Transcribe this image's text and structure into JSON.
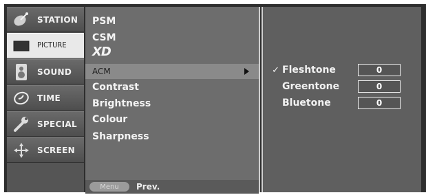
{
  "tabs": [
    {
      "label": "STATION",
      "icon": "satellite-dish-icon",
      "active": false
    },
    {
      "label": "PICTURE",
      "icon": "tv-screen-icon",
      "active": true
    },
    {
      "label": "SOUND",
      "icon": "speaker-icon",
      "active": false
    },
    {
      "label": "TIME",
      "icon": "clock-icon",
      "active": false
    },
    {
      "label": "SPECIAL",
      "icon": "wrench-icon",
      "active": false
    },
    {
      "label": "SCREEN",
      "icon": "screen-adjust-icon",
      "active": false
    }
  ],
  "menu": {
    "items": [
      {
        "label": "PSM"
      },
      {
        "label": "CSM"
      },
      {
        "label": "XD"
      },
      {
        "label": "ACM",
        "selected": true
      },
      {
        "label": "Contrast"
      },
      {
        "label": "Brightness"
      },
      {
        "label": "Colour"
      },
      {
        "label": "Sharpness"
      }
    ]
  },
  "footer": {
    "menu_button": "Menu",
    "prev_label": "Prev."
  },
  "acm": {
    "rows": [
      {
        "check": "✓",
        "label": "Fleshtone",
        "value": "0"
      },
      {
        "check": "",
        "label": "Greentone",
        "value": "0"
      },
      {
        "check": "",
        "label": "Bluetone",
        "value": "0"
      }
    ]
  },
  "colors": {
    "panel_bg": "#5f5f5f",
    "active_tab_bg": "#e9e9e9",
    "text": "#f1f1f1"
  }
}
